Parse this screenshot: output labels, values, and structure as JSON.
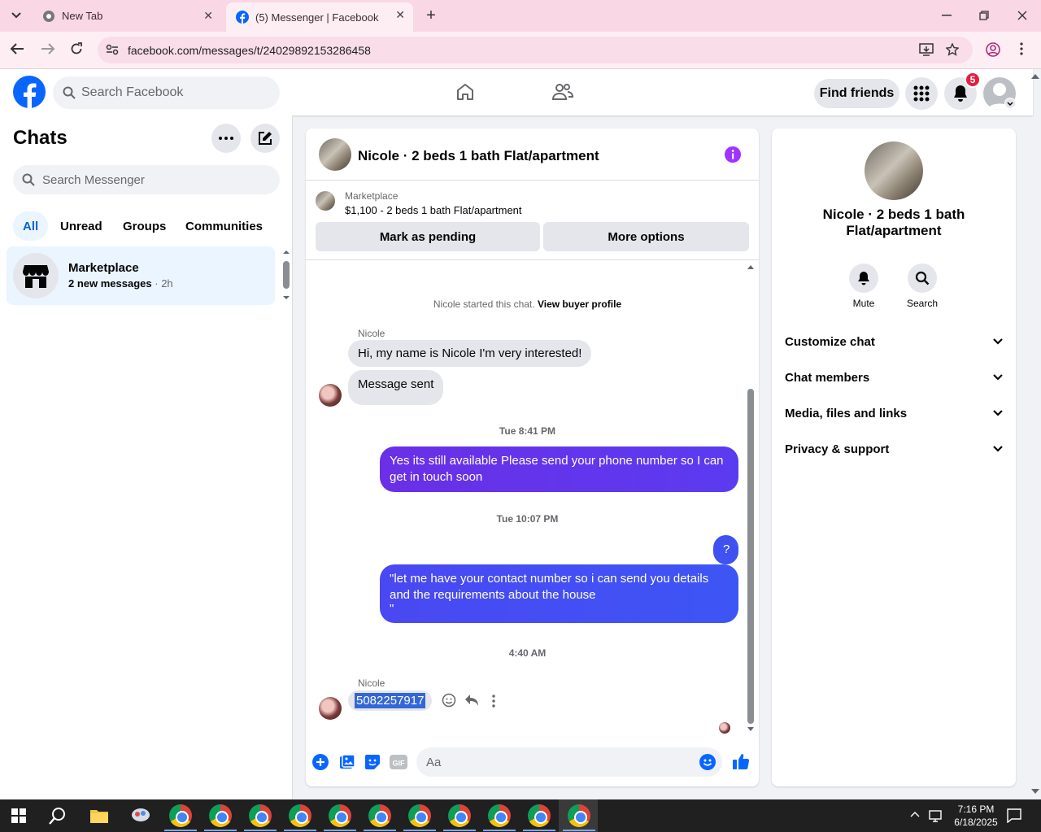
{
  "browser": {
    "tabs": [
      {
        "label": "New Tab"
      },
      {
        "label": "(5) Messenger | Facebook"
      }
    ],
    "url": "facebook.com/messages/t/24029892153286458"
  },
  "fbnav": {
    "search_placeholder": "Search Facebook",
    "find_friends": "Find friends",
    "notification_count": "5"
  },
  "chats": {
    "title": "Chats",
    "search_placeholder": "Search Messenger",
    "filters": [
      "All",
      "Unread",
      "Groups",
      "Communities"
    ],
    "items": [
      {
        "name": "Marketplace",
        "preview": "2 new messages",
        "time": "2h"
      }
    ]
  },
  "conversation": {
    "title": "Nicole · 2 beds 1 bath Flat/apartment",
    "marketplace_label": "Marketplace",
    "listing": "$1,100 - 2 beds 1 bath Flat/apartment",
    "buttons": {
      "pending": "Mark as pending",
      "more": "More options"
    },
    "started": "Nicole started this chat.",
    "buyer_profile": "View buyer profile",
    "messages": {
      "sender1": "Nicole",
      "in1": "Hi, my name is Nicole I'm very interested!",
      "in2": "Message sent",
      "time1": "Tue 8:41 PM",
      "out1": "Yes its still available Please send your phone number so I can get in touch soon",
      "time2": "Tue 10:07 PM",
      "out2": "?",
      "out3_line1": "\"let me have your contact number so i can send you details",
      "out3_line2": "and the requirements about the house",
      "out3_line3": "\"",
      "time3": "4:40 AM",
      "sender2": "Nicole",
      "in3": "5082257917"
    },
    "composer_placeholder": "Aa"
  },
  "info": {
    "title": "Nicole · 2 beds 1 bath Flat/apartment",
    "actions": [
      "Mute",
      "Search"
    ],
    "sections": [
      "Customize chat",
      "Chat members",
      "Media, files and links",
      "Privacy & support"
    ]
  },
  "taskbar": {
    "time": "7:16 PM",
    "date": "6/18/2025"
  },
  "colors": {
    "fb_blue": "#0866ff",
    "messenger_purple": "#a033ff",
    "outgoing_bubble": "#5b3bf0",
    "chrome_tab_strip": "#f9d7e5"
  }
}
